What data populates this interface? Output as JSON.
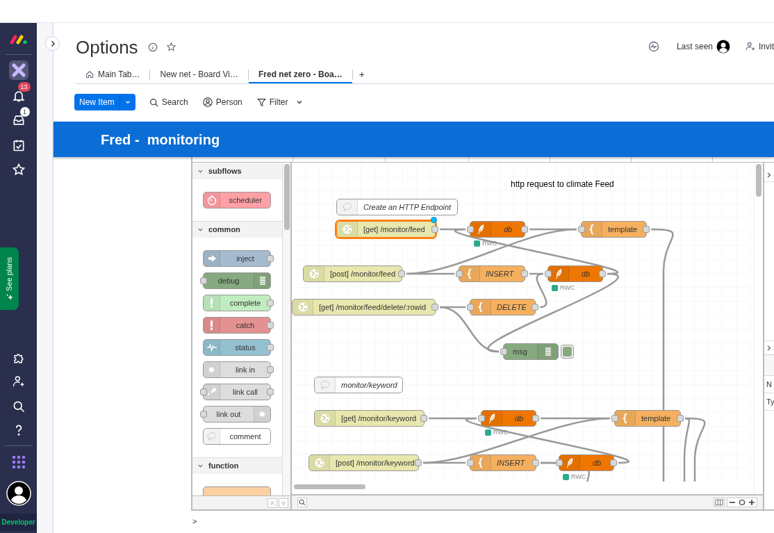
{
  "sidebar": {
    "notification_count": "13",
    "inbox_count": "1",
    "see_plans": "See plans",
    "plan": "Developer"
  },
  "board": {
    "title": "Options",
    "last_seen": "Last seen",
    "invite": "Invit"
  },
  "tabs": [
    {
      "label": "Main Tab…",
      "selected": false,
      "kind": "home"
    },
    {
      "label": "New net - Board Vi…",
      "selected": false,
      "kind": "view"
    },
    {
      "label": "Fred net zero - Boa…",
      "selected": true,
      "kind": "view"
    }
  ],
  "add_tab": "+",
  "toolbar": {
    "new_item": "New Item",
    "search": "Search",
    "person": "Person",
    "filter": "Filter"
  },
  "banner": "Fred -  monitoring",
  "palette": {
    "categories": [
      {
        "label": "subflows",
        "expanded": true,
        "nodes": [
          {
            "label": "scheduler",
            "kind": "scheduler"
          }
        ]
      },
      {
        "label": "common",
        "expanded": true,
        "nodes": [
          {
            "label": "inject",
            "kind": "inject"
          },
          {
            "label": "debug",
            "kind": "debug"
          },
          {
            "label": "complete",
            "kind": "complete"
          },
          {
            "label": "catch",
            "kind": "catch"
          },
          {
            "label": "status",
            "kind": "status"
          },
          {
            "label": "link in",
            "kind": "link-in"
          },
          {
            "label": "link call",
            "kind": "link-call"
          },
          {
            "label": "link out",
            "kind": "link-out"
          },
          {
            "label": "comment",
            "kind": "comment"
          }
        ]
      },
      {
        "label": "function",
        "expanded": true
      }
    ]
  },
  "canvas": {
    "labels": [
      "http request to climate Feed"
    ],
    "nodes": [
      {
        "kind": "comment",
        "label": "Create an HTTP Endpoint",
        "named": true,
        "selected": false
      },
      {
        "kind": "http-in",
        "label": "[get] /monitor/feed",
        "named": false,
        "selected": true,
        "changed": true
      },
      {
        "kind": "db",
        "label": "db",
        "named": true,
        "selected": false,
        "status": "RWC"
      },
      {
        "kind": "template",
        "label": "template",
        "named": false,
        "selected": false
      },
      {
        "kind": "http-in",
        "label": "[post] /monitor/feed",
        "named": false,
        "selected": false
      },
      {
        "kind": "template",
        "label": "INSERT",
        "named": true,
        "selected": false
      },
      {
        "kind": "db",
        "label": "db",
        "named": true,
        "selected": false,
        "status": "RWC"
      },
      {
        "kind": "http-in",
        "label": "[get] /monitor/feed/delete/:rowid",
        "named": false,
        "selected": false
      },
      {
        "kind": "template",
        "label": "DELETE",
        "named": true,
        "selected": false
      },
      {
        "kind": "debug",
        "label": "msg",
        "named": false,
        "selected": false,
        "active": true
      },
      {
        "kind": "comment",
        "label": "monitor/keyword",
        "named": true,
        "selected": false
      },
      {
        "kind": "http-in",
        "label": "[get] /monitor/keyword",
        "named": false,
        "selected": false
      },
      {
        "kind": "db",
        "label": "db",
        "named": true,
        "selected": false,
        "status": "RWC"
      },
      {
        "kind": "template",
        "label": "template",
        "named": false,
        "selected": false
      },
      {
        "kind": "http-in",
        "label": "[post] /monitor/keyword",
        "named": false,
        "selected": false
      },
      {
        "kind": "template",
        "label": "INSERT",
        "named": true,
        "selected": false
      },
      {
        "kind": "db",
        "label": "db",
        "named": true,
        "selected": false,
        "status": "RWC"
      }
    ]
  },
  "right_panel": {
    "rows": [
      "N",
      "Ty"
    ]
  },
  "console_prompt": ">"
}
